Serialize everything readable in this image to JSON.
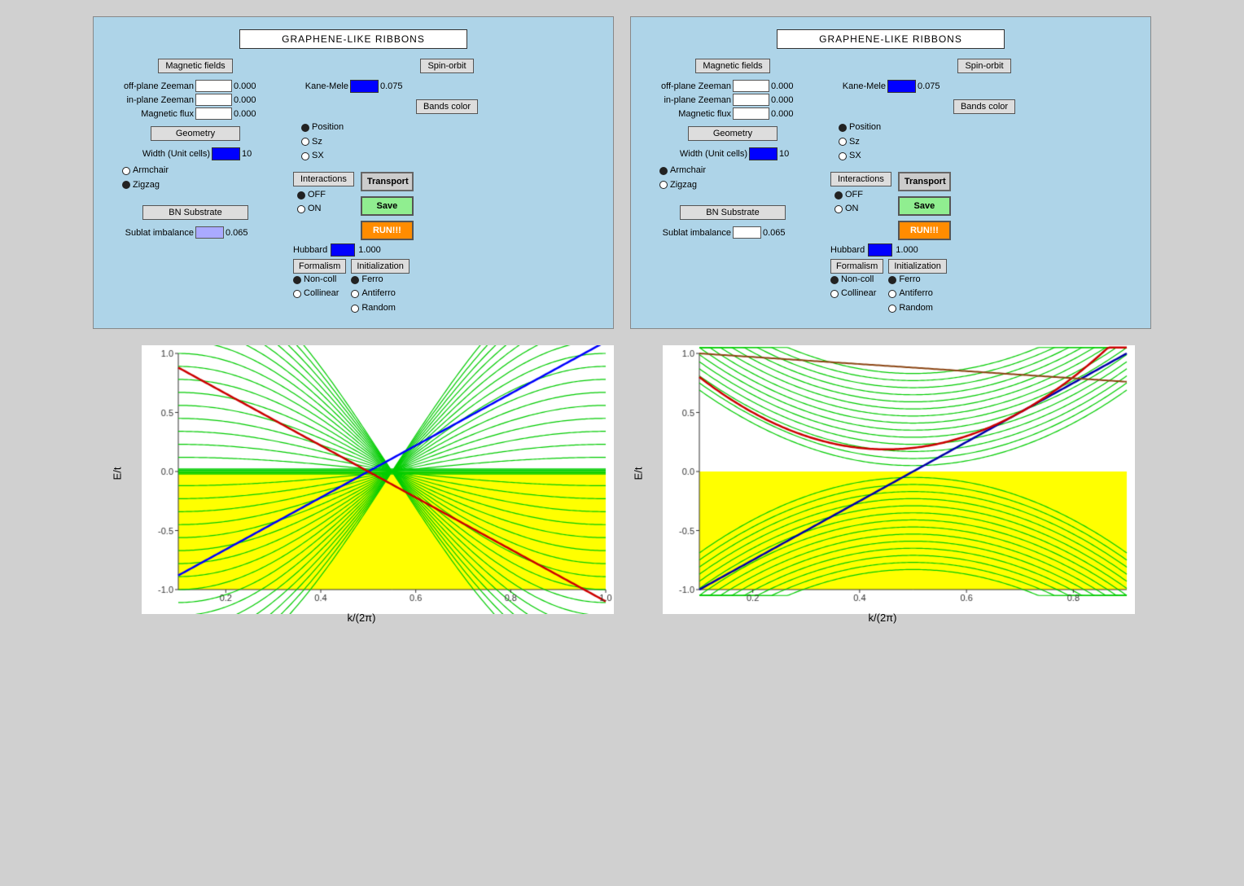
{
  "panels": [
    {
      "id": "left",
      "title": "GRAPHENE-LIKE RIBBONS",
      "magnetic_fields": {
        "label": "Magnetic fields",
        "fields": [
          {
            "name": "off-plane Zeeman",
            "value": "0.000"
          },
          {
            "name": "in-plane Zeeman",
            "value": "0.000"
          },
          {
            "name": "Magnetic flux",
            "value": "0.000"
          }
        ]
      },
      "spin_orbit": {
        "label": "Spin-orbit",
        "kane_mele_label": "Kane-Mele",
        "kane_mele_value": "0.075"
      },
      "bands_color": {
        "label": "Bands color",
        "options": [
          "Position",
          "Sz",
          "SX"
        ],
        "selected": 0
      },
      "geometry": {
        "label": "Geometry",
        "width_label": "Width (Unit cells)",
        "width_value": "10",
        "options": [
          "Armchair",
          "Zigzag"
        ],
        "selected": 1
      },
      "interactions": {
        "label": "Interactions",
        "options": [
          "OFF",
          "ON"
        ],
        "selected": 0
      },
      "hubbard": {
        "label": "Hubbard",
        "value": "1.000"
      },
      "bn_substrate": {
        "label": "BN Substrate",
        "sublat_label": "Sublat imbalance",
        "sublat_value": "0.065"
      },
      "formalism": {
        "label": "Formalism",
        "options": [
          "Non-coll",
          "Collinear"
        ],
        "selected": 0
      },
      "initialization": {
        "label": "Initialization",
        "options": [
          "Ferro",
          "Antiferro",
          "Random"
        ],
        "selected": 0
      },
      "buttons": {
        "transport": "Transport",
        "save": "Save",
        "run": "RUN!!!"
      }
    },
    {
      "id": "right",
      "title": "GRAPHENE-LIKE RIBBONS",
      "magnetic_fields": {
        "label": "Magnetic fields",
        "fields": [
          {
            "name": "off-plane Zeeman",
            "value": "0.000"
          },
          {
            "name": "in-plane Zeeman",
            "value": "0.000"
          },
          {
            "name": "Magnetic flux",
            "value": "0.000"
          }
        ]
      },
      "spin_orbit": {
        "label": "Spin-orbit",
        "kane_mele_label": "Kane-Mele",
        "kane_mele_value": "0.075"
      },
      "bands_color": {
        "label": "Bands color",
        "options": [
          "Position",
          "Sz",
          "SX"
        ],
        "selected": 0
      },
      "geometry": {
        "label": "Geometry",
        "width_label": "Width (Unit cells)",
        "width_value": "10",
        "options": [
          "Armchair",
          "Zigzag"
        ],
        "selected": 0
      },
      "interactions": {
        "label": "Interactions",
        "options": [
          "OFF",
          "ON"
        ],
        "selected": 0
      },
      "hubbard": {
        "label": "Hubbard",
        "value": "1.000"
      },
      "bn_substrate": {
        "label": "BN Substrate",
        "sublat_label": "Sublat imbalance",
        "sublat_value": "0.065"
      },
      "formalism": {
        "label": "Formalism",
        "options": [
          "Non-coll",
          "Collinear"
        ],
        "selected": 0
      },
      "initialization": {
        "label": "Initialization",
        "options": [
          "Ferro",
          "Antiferro",
          "Random"
        ],
        "selected": 0
      },
      "buttons": {
        "transport": "Transport",
        "save": "Save",
        "run": "RUN!!!"
      }
    }
  ],
  "charts": [
    {
      "id": "left-chart",
      "ylabel": "E/t",
      "xlabel": "k/(2π)",
      "yticks": [
        "1.0",
        "0.5",
        "0.0",
        "-0.5",
        "-1.0"
      ],
      "xticks": [
        "0.2",
        "0.4",
        "0.6",
        "0.8",
        "1.0"
      ],
      "type": "zigzag"
    },
    {
      "id": "right-chart",
      "ylabel": "E/t",
      "xlabel": "k/(2π)",
      "yticks": [
        "1.0",
        "0.5",
        "0.0",
        "-0.5",
        "-1.0"
      ],
      "xticks": [
        "0.2",
        "0.4",
        "0.6",
        "0.8"
      ],
      "type": "armchair"
    }
  ]
}
